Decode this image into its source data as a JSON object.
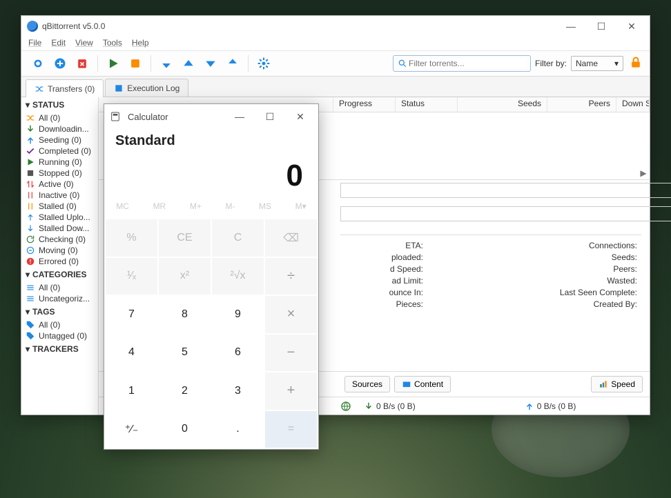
{
  "qb": {
    "title": "qBittorrent v5.0.0",
    "menu": [
      "File",
      "Edit",
      "View",
      "Tools",
      "Help"
    ],
    "search_placeholder": "Filter torrents...",
    "filterby_label": "Filter by:",
    "filterby_value": "Name",
    "tabs": {
      "transfers": "Transfers (0)",
      "execlog": "Execution Log"
    },
    "sidebar": {
      "status_head": "STATUS",
      "status": [
        "All (0)",
        "Downloadin...",
        "Seeding (0)",
        "Completed (0)",
        "Running (0)",
        "Stopped (0)",
        "Active (0)",
        "Inactive (0)",
        "Stalled (0)",
        "Stalled Uplo...",
        "Stalled Dow...",
        "Checking (0)",
        "Moving (0)",
        "Errored (0)"
      ],
      "categories_head": "CATEGORIES",
      "categories": [
        "All (0)",
        "Uncategoriz..."
      ],
      "tags_head": "TAGS",
      "tags": [
        "All (0)",
        "Untagged (0)"
      ],
      "trackers_head": "TRACKERS"
    },
    "columns": [
      "Progress",
      "Status",
      "Seeds",
      "Peers",
      "Down S"
    ],
    "details": {
      "left": [
        "ETA:",
        "ploaded:",
        "d Speed:",
        "ad Limit:",
        "ounce In:",
        "Pieces:"
      ],
      "right": [
        "Connections:",
        "Seeds:",
        "Peers:",
        "Wasted:",
        "Last Seen Complete:",
        "Created By:"
      ]
    },
    "btabs": {
      "sources": "Sources",
      "content": "Content",
      "speed": "Speed"
    },
    "status_down": "0 B/s (0 B)",
    "status_up": "0 B/s (0 B)"
  },
  "calc": {
    "title": "Calculator",
    "mode": "Standard",
    "display": "0",
    "mem": [
      "MC",
      "MR",
      "M+",
      "M-",
      "MS",
      "M▾"
    ],
    "keys": [
      {
        "t": "%",
        "c": "f"
      },
      {
        "t": "CE",
        "c": "f"
      },
      {
        "t": "C",
        "c": "f"
      },
      {
        "t": "⌫",
        "c": "f"
      },
      {
        "t": "¹⁄ₓ",
        "c": "f"
      },
      {
        "t": "x²",
        "c": "f"
      },
      {
        "t": "²√x",
        "c": "f"
      },
      {
        "t": "÷",
        "c": "op"
      },
      {
        "t": "7",
        "c": "num"
      },
      {
        "t": "8",
        "c": "num"
      },
      {
        "t": "9",
        "c": "num"
      },
      {
        "t": "×",
        "c": "op"
      },
      {
        "t": "4",
        "c": "num"
      },
      {
        "t": "5",
        "c": "num"
      },
      {
        "t": "6",
        "c": "num"
      },
      {
        "t": "−",
        "c": "op"
      },
      {
        "t": "1",
        "c": "num"
      },
      {
        "t": "2",
        "c": "num"
      },
      {
        "t": "3",
        "c": "num"
      },
      {
        "t": "+",
        "c": "op"
      },
      {
        "t": "⁺⁄₋",
        "c": "num"
      },
      {
        "t": "0",
        "c": "num"
      },
      {
        "t": ".",
        "c": "num"
      },
      {
        "t": "=",
        "c": "eq"
      }
    ]
  }
}
